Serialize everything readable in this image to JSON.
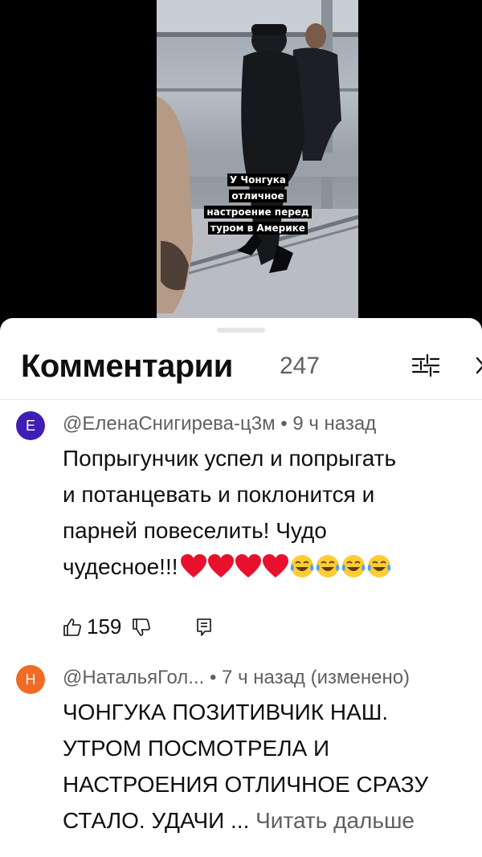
{
  "video": {
    "caption": "У Чонгука отличное настроение перед туром в Америке"
  },
  "comments_panel": {
    "title": "Комментарии",
    "count": "247",
    "filter_icon": "sliders-icon",
    "close_icon": "close-icon"
  },
  "comments": [
    {
      "avatar_letter": "Е",
      "avatar_color": "#3f1fb3",
      "author": "@ЕленаСнигирева-ц3м",
      "time": "• 9 ч назад",
      "text_lines": [
        "Попрыгунчик успел и попрыгать",
        "и потанцевать и поклонится и",
        "парней повеселить! Чудо",
        "чудесное!!!"
      ],
      "emojis": [
        "heart",
        "heart",
        "heart",
        "heart",
        "tears-of-joy",
        "tears-of-joy",
        "tears-of-joy",
        "tears-of-joy"
      ],
      "likes": "159"
    },
    {
      "avatar_letter": "Н",
      "avatar_color": "#f06b23",
      "author": "@НатальяГол...",
      "time": "• 7 ч назад (изменено)",
      "text_lines": [
        "ЧОНГУКА ПОЗИТИВЧИК НАШ.",
        "УТРОМ ПОСМОТРЕЛА И",
        "НАСТРОЕНИЯ ОТЛИЧНОЕ СРАЗУ",
        "СТАЛО. УДАЧИ ..."
      ],
      "read_more": "Читать дальше"
    }
  ]
}
